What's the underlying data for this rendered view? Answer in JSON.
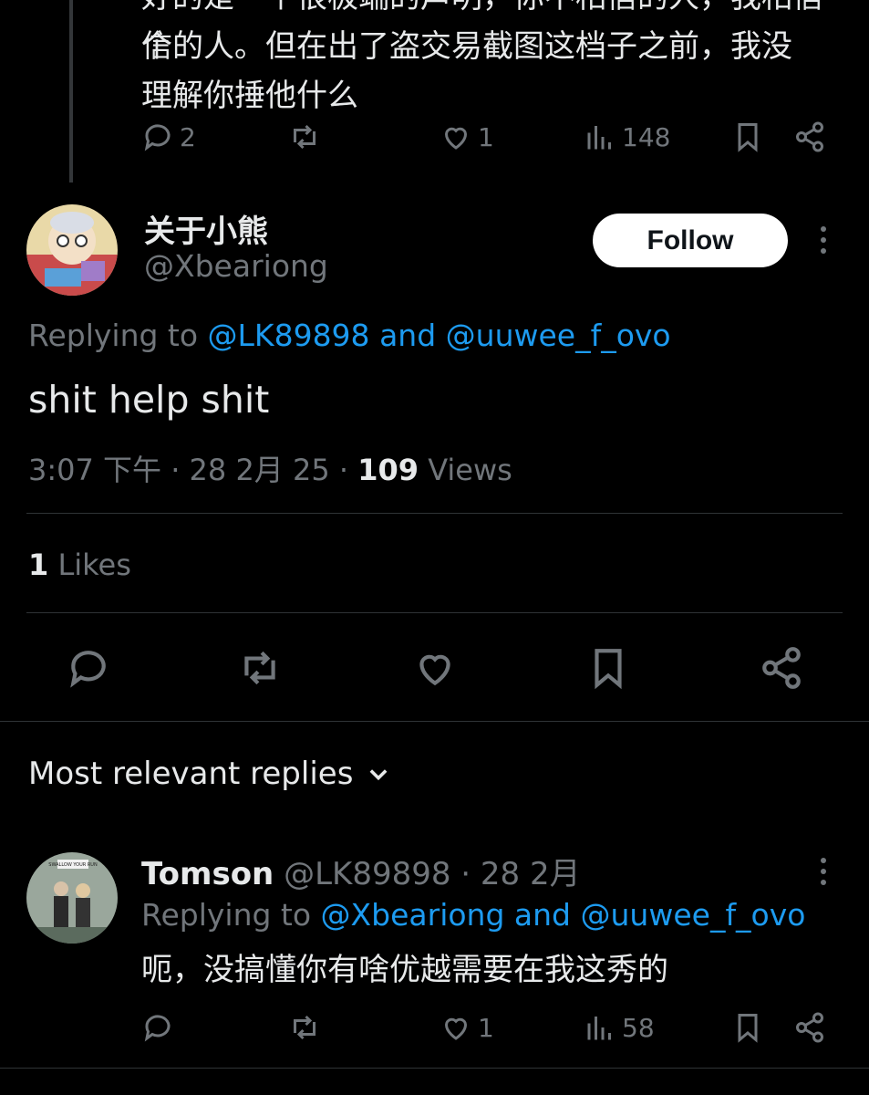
{
  "parent_tweet": {
    "text_line_partial": "好的是一个很极端的声明，你不相信的人，我相信一个",
    "text_line1": "信的人。但在出了盗交易截图这档子之前，我没",
    "text_line2": "理解你捶他什么",
    "actions": {
      "replies": "2",
      "retweets": "",
      "likes": "1",
      "views": "148"
    }
  },
  "main_tweet": {
    "display_name": "关于小熊",
    "handle": "@Xbeariong",
    "follow_label": "Follow",
    "replying_prefix": "Replying to",
    "reply_user1": "@LK89898",
    "reply_and": "and",
    "reply_user2": "@uuwee_f_ovo",
    "text": "shit help shit",
    "timestamp": "3:07 下午 · 28 2月 25 · ",
    "views_count": "109",
    "views_label": " Views",
    "likes_count": "1",
    "likes_label": " Likes"
  },
  "replies_section": {
    "sort_label": "Most relevant replies"
  },
  "reply": {
    "display_name": "Tomson",
    "handle": "@LK89898",
    "date": " · 28 2月",
    "replying_prefix": "Replying to",
    "reply_user1": "@Xbeariong",
    "reply_and": "and",
    "reply_user2": "@uuwee_f_ovo",
    "text": "呃，没搞懂你有啥优越需要在我这秀的",
    "avatar_sign": "SWALLOW YOUR RUN",
    "actions": {
      "replies": "",
      "retweets": "",
      "likes": "1",
      "views": "58"
    }
  },
  "colors": {
    "accent": "#1d9bf0",
    "muted": "#71767b",
    "text": "#e7e9ea",
    "bg": "#000000"
  }
}
